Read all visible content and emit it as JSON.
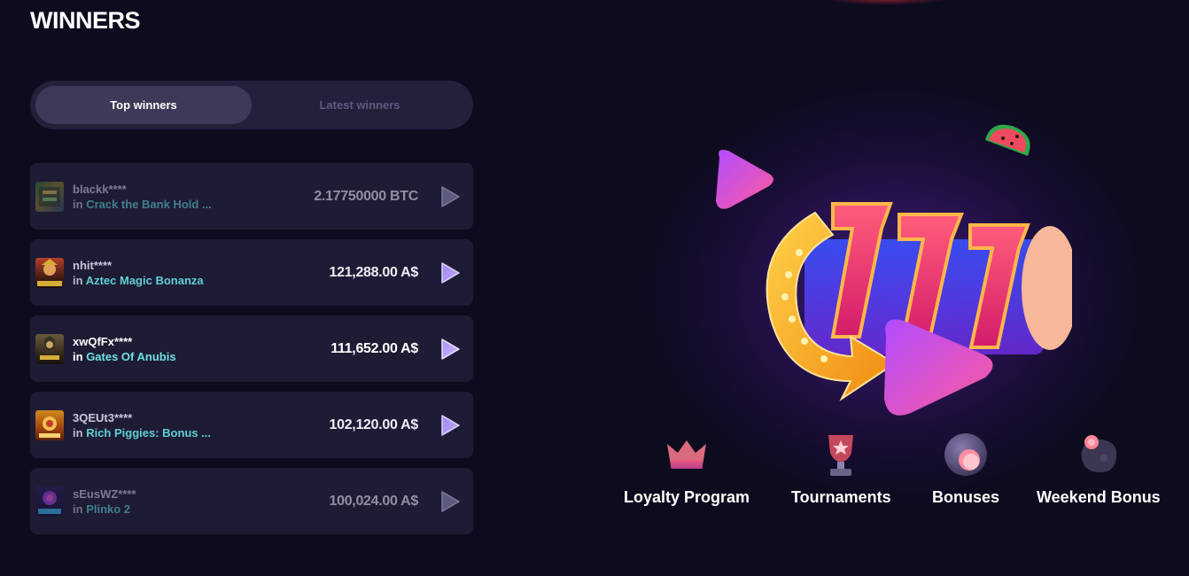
{
  "page": {
    "title": "WINNERS"
  },
  "tabs": [
    {
      "label": "Top winners",
      "active": true
    },
    {
      "label": "Latest winners",
      "active": false
    }
  ],
  "winners": [
    {
      "user": "blackk****",
      "prefix": "in",
      "game": "Crack the Bank Hold ...",
      "amount": "2.17750000 BTC",
      "thumb": "crack-the-bank-thumb"
    },
    {
      "user": "nhit****",
      "prefix": "in",
      "game": "Aztec Magic Bonanza",
      "amount": "121,288.00 A$",
      "thumb": "aztec-magic-thumb"
    },
    {
      "user": "xwQfFx****",
      "prefix": "in",
      "game": "Gates Of Anubis",
      "amount": "111,652.00 A$",
      "thumb": "gates-of-anubis-thumb"
    },
    {
      "user": "3QEUt3****",
      "prefix": "in",
      "game": "Rich Piggies: Bonus ...",
      "amount": "102,120.00 A$",
      "thumb": "rich-piggies-thumb"
    },
    {
      "user": "sEusWZ****",
      "prefix": "in",
      "game": "Plinko 2",
      "amount": "100,024.00 A$",
      "thumb": "plinko-thumb"
    }
  ],
  "features": [
    {
      "label": "Loyalty Program",
      "icon": "crown-icon"
    },
    {
      "label": "Tournaments",
      "icon": "trophy-icon"
    },
    {
      "label": "Bonuses",
      "icon": "bonus-orb-icon"
    },
    {
      "label": "Weekend Bonus",
      "icon": "weekend-bonus-icon"
    }
  ],
  "colors": {
    "background": "#0d0b1e",
    "row": "#1e1b35",
    "tab_active": "#3d3958",
    "game_link": "#5fd0d3",
    "accent_purple": "#8a5cf6"
  }
}
